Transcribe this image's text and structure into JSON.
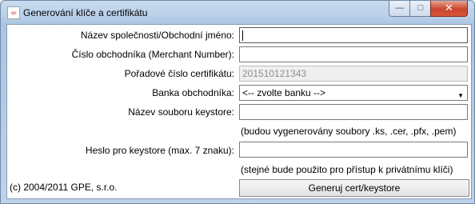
{
  "window": {
    "title": "Generování klíče a certifikátu",
    "minimize_glyph": "—",
    "maximize_glyph": "□",
    "close_glyph": "✕"
  },
  "form": {
    "company_label": "Název společnosti/Obchodní jméno:",
    "company_value": "",
    "merchant_label": "Číslo obchodníka (Merchant Number):",
    "merchant_value": "",
    "serial_label": "Pořadové číslo certifikátu:",
    "serial_value": "201510121343",
    "bank_label": "Banka obchodníka:",
    "bank_selected": "<-- zvolte banku -->",
    "keystore_file_label": "Název souboru keystore:",
    "keystore_file_value": "",
    "keystore_file_hint": "(budou vygenerovány soubory .ks, .cer, .pfx, .pem)",
    "password_label": "Heslo pro keystore (max. 7 znaku):",
    "password_value": "",
    "password_hint": "(stejné bude použito pro přístup k privátnímu klíči)"
  },
  "footer": {
    "copyright": "(c) 2004/2011 GPE, s.r.o.",
    "generate_button": "Generuj cert/keystore"
  },
  "icons": {
    "app": "java-icon",
    "dropdown": "chevron-down-icon"
  }
}
